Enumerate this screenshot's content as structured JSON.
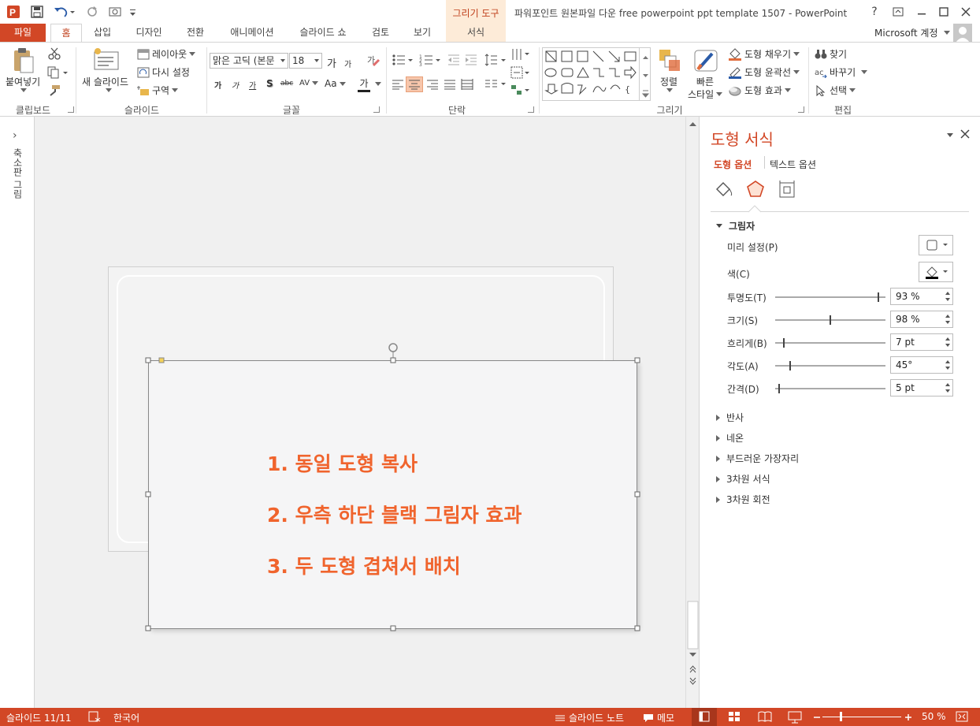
{
  "window": {
    "title": "파워포인트 원본파일 다운 free powerpoint ppt template 1507 - PowerPoint",
    "context_group": "그리기 도구",
    "account": "Microsoft 계정",
    "help": "?"
  },
  "tabs": [
    "파일",
    "홈",
    "삽입",
    "디자인",
    "전환",
    "애니메이션",
    "슬라이드 쇼",
    "검토",
    "보기",
    "서식"
  ],
  "ribbon": {
    "clipboard": {
      "paste": "붙여넣기",
      "group": "클립보드"
    },
    "slides": {
      "new_slide": "새 슬라이드",
      "layout": "레이아웃",
      "reset": "다시 설정",
      "section": "구역",
      "group": "슬라이드"
    },
    "font": {
      "font_name": "맑은 고딕 (본문",
      "font_size": "18",
      "grow": "가",
      "shrink": "가",
      "bold": "가",
      "italic": "가",
      "underline": "가",
      "shadow": "S",
      "strike": "abc",
      "spacing": "AV",
      "case": "Aa",
      "color": "가",
      "group": "글꼴"
    },
    "paragraph": {
      "group": "단락"
    },
    "drawing": {
      "arrange": "정렬",
      "quick_styles_1": "빠른",
      "quick_styles_2": "스타일",
      "fill": "도형 채우기",
      "outline": "도형 윤곽선",
      "effects": "도형 효과",
      "group": "그리기"
    },
    "editing": {
      "find": "찾기",
      "replace": "바꾸기",
      "select": "선택",
      "group": "편집"
    }
  },
  "left_pane": {
    "label": "축소판 그림",
    "expand": "›"
  },
  "slide": {
    "lines": [
      "1. 동일 도형 복사",
      "2. 우측 하단 블랙 그림자 효과",
      "3. 두 도형 겹쳐서 배치"
    ]
  },
  "format_pane": {
    "title": "도형 서식",
    "tab_shape": "도형 옵션",
    "tab_text": "텍스트 옵션",
    "section_shadow": "그림자",
    "presets_label": "미리 설정(P)",
    "color_label": "색(C)",
    "transparency_label": "투명도(T)",
    "transparency_value": "93 %",
    "transparency_level": 93,
    "size_label": "크기(S)",
    "size_value": "98 %",
    "size_level": 49,
    "blur_label": "흐리게(B)",
    "blur_value": "7 pt",
    "blur_level": 7,
    "angle_label": "각도(A)",
    "angle_value": "45°",
    "angle_level": 13,
    "distance_label": "간격(D)",
    "distance_value": "5 pt",
    "distance_level": 3,
    "collapsed_sections": [
      "반사",
      "네온",
      "부드러운 가장자리",
      "3차원 서식",
      "3차원 회전"
    ]
  },
  "status": {
    "slide_info": "슬라이드 11/11",
    "language": "한국어",
    "notes": "슬라이드 노트",
    "comments": "메모",
    "zoom": "50 %"
  },
  "colors": {
    "accent": "#d24726",
    "slide_text": "#f0642d",
    "context_tab_bg": "#fdebd8"
  }
}
